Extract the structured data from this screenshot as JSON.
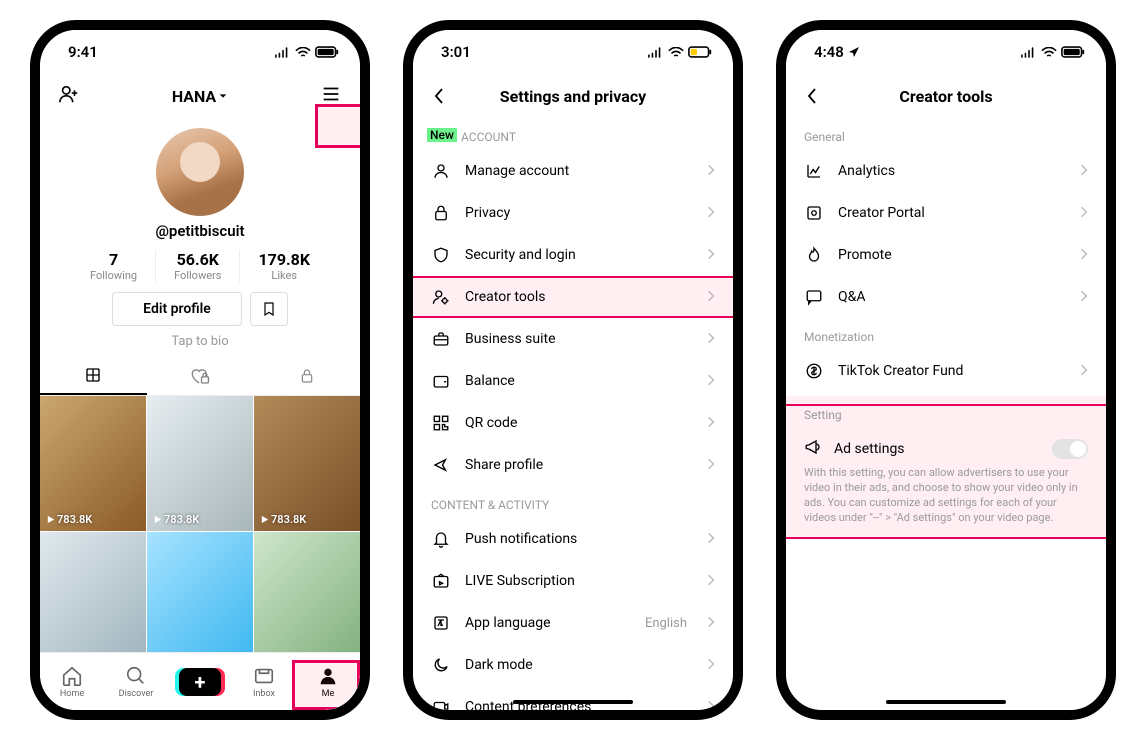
{
  "phone1": {
    "status_time": "9:41",
    "battery_style": "black",
    "header": {
      "account_name": "HANA"
    },
    "username": "@petitbiscuit",
    "stats": {
      "following": {
        "value": "7",
        "label": "Following"
      },
      "followers": {
        "value": "56.6K",
        "label": "Followers"
      },
      "likes": {
        "value": "179.8K",
        "label": "Likes"
      }
    },
    "edit_profile_label": "Edit profile",
    "bio_hint": "Tap to bio",
    "video_views": "783.8K",
    "bottom_nav": {
      "home": "Home",
      "discover": "Discover",
      "inbox": "Inbox",
      "me": "Me"
    }
  },
  "phone2": {
    "status_time": "3:01",
    "title": "Settings and privacy",
    "new_badge": "New",
    "section_account": "ACCOUNT",
    "items_account": {
      "manage_account": "Manage account",
      "privacy": "Privacy",
      "security": "Security and login",
      "creator_tools": "Creator tools",
      "business_suite": "Business suite",
      "balance": "Balance",
      "qr_code": "QR code",
      "share_profile": "Share profile"
    },
    "section_content": "CONTENT & ACTIVITY",
    "items_content": {
      "push": "Push notifications",
      "live_sub": "LIVE Subscription",
      "app_lang": "App language",
      "app_lang_value": "English",
      "dark_mode": "Dark mode",
      "content_prefs": "Content preferences"
    }
  },
  "phone3": {
    "status_time": "4:48",
    "title": "Creator tools",
    "section_general": "General",
    "items_general": {
      "analytics": "Analytics",
      "creator_portal": "Creator Portal",
      "promote": "Promote",
      "qa": "Q&A"
    },
    "section_monetization": "Monetization",
    "items_monetization": {
      "creator_fund": "TikTok Creator Fund"
    },
    "section_setting": "Setting",
    "ad_settings": {
      "title": "Ad settings",
      "description": "With this setting, you can allow advertisers to use your video in their ads, and choose to show your video only in ads. You can customize ad settings for each of your videos under \"--\" > \"Ad settings\" on your video page."
    }
  }
}
